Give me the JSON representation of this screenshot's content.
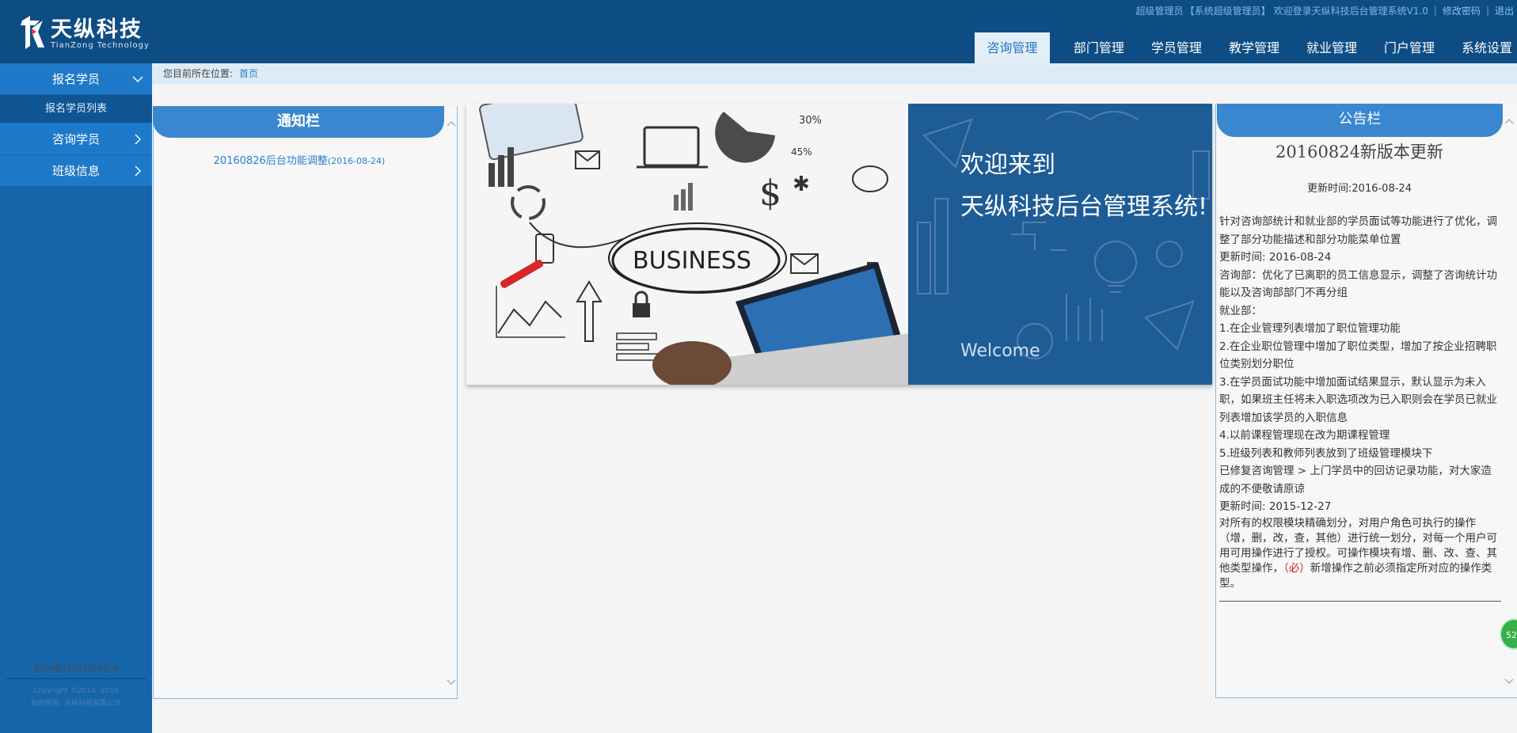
{
  "brand": {
    "name_cn": "天纵科技",
    "name_en": "TianZong Technology"
  },
  "topbar": {
    "role": "超级管理员",
    "role_title": "【系统超级管理员】",
    "welcome": "欢迎登录天纵科技后台管理系统V1.0",
    "change_password": "修改密码",
    "logout": "退出"
  },
  "nav": {
    "items": [
      {
        "label": "咨询管理",
        "active": true
      },
      {
        "label": "部门管理"
      },
      {
        "label": "学员管理"
      },
      {
        "label": "教学管理"
      },
      {
        "label": "就业管理"
      },
      {
        "label": "门户管理"
      },
      {
        "label": "系统设置"
      }
    ]
  },
  "sidebar": {
    "items": [
      {
        "label": "报名学员",
        "expanded": true,
        "icon": "chevron-down-icon"
      },
      {
        "label": "报名学员列表",
        "sub": true
      },
      {
        "label": "咨询学员",
        "icon": "chevron-right-icon"
      },
      {
        "label": "班级信息",
        "icon": "chevron-right-icon"
      }
    ],
    "icp": "京ICP备11017824号-4",
    "copyright": "Copyright ©2014 -2016",
    "rights": "版权所有: 天纵科技有限公司"
  },
  "breadcrumb": {
    "label": "您目前所在位置:",
    "current": "首页"
  },
  "notice": {
    "title": "通知栏",
    "items": [
      {
        "title": "20160826后台功能调整",
        "date": "(2016-08-24)"
      }
    ]
  },
  "banner": {
    "line1": "欢迎来到",
    "line2": "天纵科技后台管理系统!",
    "welcome": "Welcome",
    "word": "BUSINESS"
  },
  "bulletin": {
    "title": "公告栏",
    "headline": "20160824新版本更新",
    "update_time": "更新时间:2016-08-24",
    "paragraphs": [
      "针对咨询部统计和就业部的学员面试等功能进行了优化，调整了部分功能描述和部分功能菜单位置",
      "更新时间: 2016-08-24",
      "咨询部：优化了已离职的员工信息显示，调整了咨询统计功能以及咨询部部门不再分组",
      "就业部：",
      "1.在企业管理列表增加了职位管理功能",
      "2.在企业职位管理中增加了职位类型，增加了按企业招聘职位类别划分职位",
      "3.在学员面试功能中增加面试结果显示，默认显示为未入职，如果班主任将未入职选项改为已入职则会在学员已就业列表增加该学员的入职信息",
      "4.以前课程管理现在改为期课程管理",
      "5.班级列表和教师列表放到了班级管理模块下",
      "已修复咨询管理 > 上门学员中的回访记录功能，对大家造成的不便敬请原谅",
      "更新时间: 2015-12-27"
    ],
    "last_pre": "对所有的权限模块精确划分，对用户角色可执行的操作（增，删，改，查，其他）进行统一划分，对每一个用户可用可用操作进行了授权。可操作模块有增、删、改、查、其他类型操作，",
    "last_red": "（必）",
    "last_post": "新增操作之前必须指定所对应的操作类型。",
    "badge": "52"
  }
}
